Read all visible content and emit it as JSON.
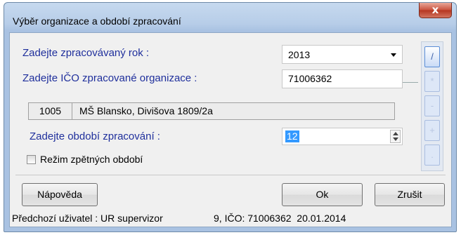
{
  "window": {
    "title": "Výběr organizace a období zpracování",
    "close_glyph": "x"
  },
  "year": {
    "label": "Zadejte zpracovávaný rok :",
    "value": "2013"
  },
  "ico": {
    "label": "Zadejte IČO zpracované organizace :",
    "value": "71006362"
  },
  "organization": {
    "code": "1005",
    "name": "MŠ Blansko, Divišova 1809/2a"
  },
  "period": {
    "label": "Zadejte období zpracování :",
    "value": "12"
  },
  "retro": {
    "label": "Režim zpětných období",
    "checked": false
  },
  "side_buttons": [
    "/",
    "*",
    "-",
    "+",
    "."
  ],
  "buttons": {
    "help": "Nápověda",
    "ok": "Ok",
    "cancel": "Zrušit"
  },
  "status": {
    "previous_user": "Předchozí uživatel : UR supervizor",
    "info": "9, IČO: 71006362  20.01.2014"
  }
}
